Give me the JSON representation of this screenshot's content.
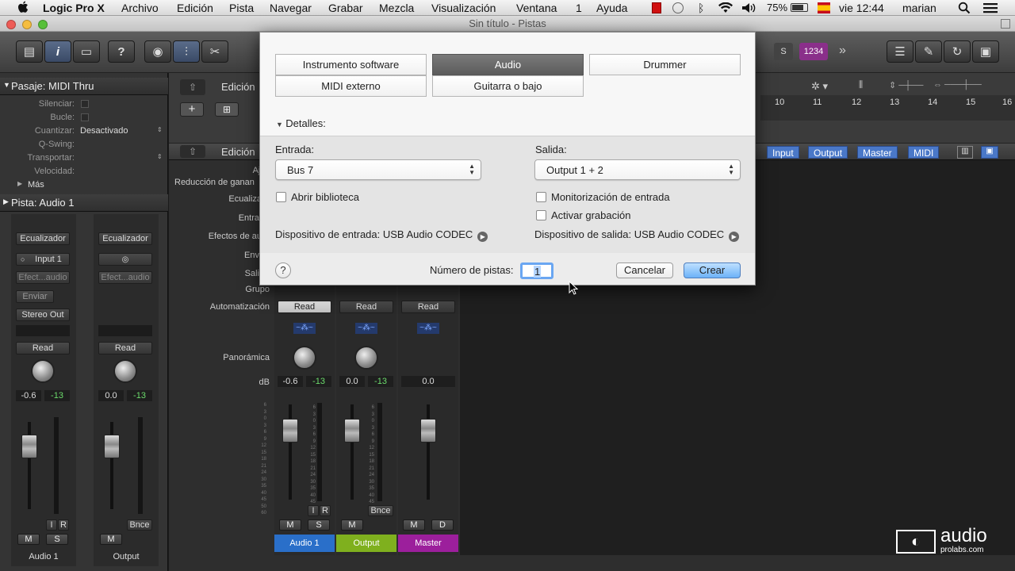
{
  "menubar": {
    "app": "Logic Pro X",
    "items": [
      "Archivo",
      "Edición",
      "Pista",
      "Navegar",
      "Grabar",
      "Mezcla",
      "Visualización",
      "Ventana",
      "1",
      "Ayuda"
    ],
    "battery": "75%",
    "clock": "vie 12:44",
    "user": "marian"
  },
  "window": {
    "title": "Sin título - Pistas"
  },
  "controlbar": {
    "lcd": "1234"
  },
  "inspector": {
    "region_header": "Pasaje: MIDI Thru",
    "rows": [
      "Silenciar:",
      "Bucle:",
      "Cuantizar:",
      "Q-Swing:",
      "Transportar:",
      "Velocidad:"
    ],
    "quantize_value": "Desactivado",
    "more": "Más",
    "track_header": "Pista: Audio 1",
    "strip1": {
      "eq": "Ecualizador",
      "input": "Input 1",
      "fx": "Efect...audio",
      "send": "Enviar",
      "output": "Stereo Out",
      "auto": "Read",
      "pan_db": "-0.6",
      "peak": "-13",
      "i": "I",
      "r": "R",
      "m": "M",
      "s": "S",
      "name": "Audio 1"
    },
    "strip2": {
      "eq": "Ecualizador",
      "fx": "Efect...audio",
      "auto": "Read",
      "pan_db": "0.0",
      "peak": "-13",
      "bnce": "Bnce",
      "m": "M",
      "name": "Output"
    }
  },
  "tracks": {
    "edit1": "Edición",
    "edit2": "Edición",
    "ruler": [
      "10",
      "11",
      "12",
      "13",
      "14",
      "15",
      "16"
    ],
    "mixer_tabs": [
      "Input",
      "Output",
      "Master",
      "MIDI"
    ]
  },
  "mixer": {
    "labels": [
      "Ajus",
      "Reducción de ganan",
      "Ecualiza",
      "Entra",
      "Efectos de au",
      "Env",
      "Sali",
      "Grupo",
      "Automatización",
      "Panorámica",
      "dB"
    ],
    "strips": [
      {
        "auto": "Read",
        "db": "-0.6",
        "peak": "-13",
        "i": "I",
        "r": "R",
        "m": "M",
        "s": "S",
        "name": "Audio 1",
        "color": "#2a6fc9"
      },
      {
        "auto": "Read",
        "db": "0.0",
        "peak": "-13",
        "bnce": "Bnce",
        "m": "M",
        "name": "Output",
        "color": "#7fb01e"
      },
      {
        "auto": "Read",
        "db": "0.0",
        "m": "M",
        "d": "D",
        "name": "Master",
        "color": "#9c1f9c"
      }
    ]
  },
  "dialog": {
    "types": [
      "Instrumento software",
      "Audio",
      "Drummer",
      "MIDI externo",
      "Guitarra o bajo"
    ],
    "selected": "Audio",
    "details": "Detalles:",
    "input_label": "Entrada:",
    "input_value": "Bus 7",
    "output_label": "Salida:",
    "output_value": "Output 1 + 2",
    "open_library": "Abrir biblioteca",
    "input_monitoring": "Monitorización de entrada",
    "record_enable": "Activar grabación",
    "input_device": "Dispositivo de entrada: USB Audio CODEC",
    "output_device": "Dispositivo de salida: USB Audio CODEC",
    "help": "?",
    "count_label": "Número de pistas:",
    "count_value": "1",
    "cancel": "Cancelar",
    "create": "Crear"
  },
  "watermark": {
    "line1": "audio",
    "line2": "prolabs.com"
  }
}
